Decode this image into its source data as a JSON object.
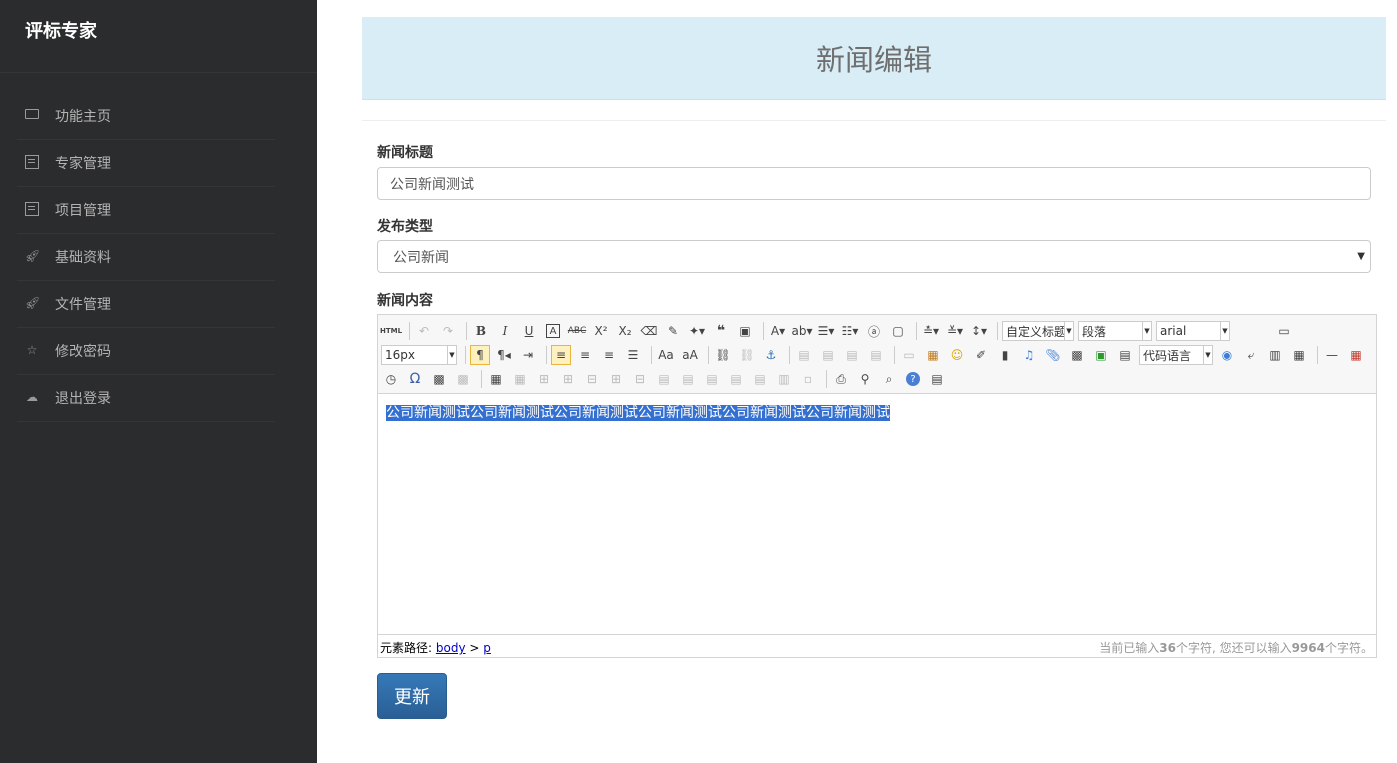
{
  "app": {
    "brand": "评标专家"
  },
  "sidebar": {
    "items": [
      {
        "label": "功能主页",
        "icon": "monitor-icon"
      },
      {
        "label": "专家管理",
        "icon": "document-icon"
      },
      {
        "label": "项目管理",
        "icon": "document-icon"
      },
      {
        "label": "基础资料",
        "icon": "rocket-icon"
      },
      {
        "label": "文件管理",
        "icon": "rocket-icon"
      },
      {
        "label": "修改密码",
        "icon": "star-icon"
      },
      {
        "label": "退出登录",
        "icon": "cloud-icon"
      }
    ]
  },
  "header": {
    "title": "新闻编辑"
  },
  "form": {
    "title_label": "新闻标题",
    "title_value": "公司新闻测试",
    "type_label": "发布类型",
    "type_value": "公司新闻",
    "content_label": "新闻内容",
    "submit_label": "更新"
  },
  "editor": {
    "toolbar": {
      "html_label": "HTML",
      "custom_title": "自定义标题",
      "paragraph": "段落",
      "font": "arial",
      "font_size": "16px",
      "code_lang": "代码语言"
    },
    "content": "公司新闻测试公司新闻测试公司新闻测试公司新闻测试公司新闻测试公司新闻测试",
    "status": {
      "path_prefix": "元素路径:",
      "path_body": "body",
      "path_sep": ">",
      "path_p": "p",
      "count_prefix": "当前已输入",
      "count_current": "36",
      "count_mid": "个字符, 您还可以输入",
      "count_remaining": "9964",
      "count_suffix": "个字符。"
    }
  },
  "colors": {
    "sidebar_bg": "#2b2c2d",
    "header_bg": "#d9edf7",
    "button_bg": "#2e6aa6",
    "selection": "#3470d1"
  }
}
